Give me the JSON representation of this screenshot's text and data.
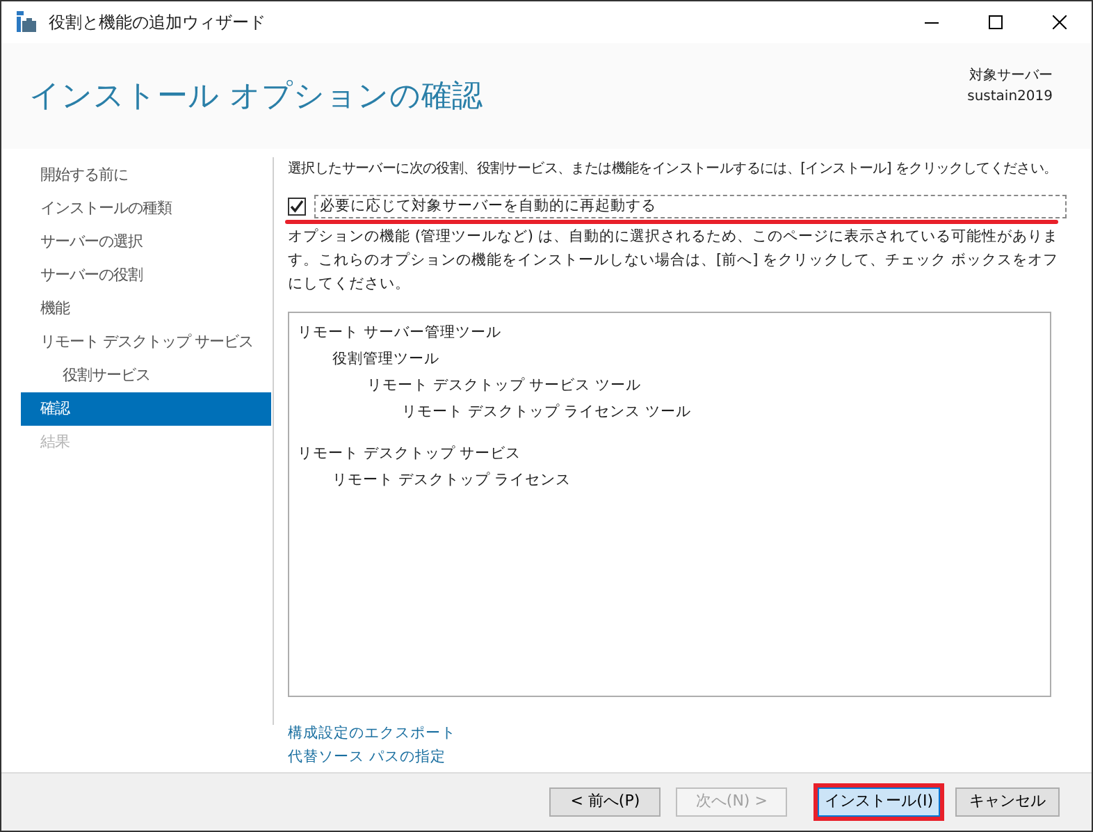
{
  "window": {
    "title": "役割と機能の追加ウィザード"
  },
  "header": {
    "title": "インストール オプションの確認",
    "target_label": "対象サーバー",
    "target_server": "sustain2019"
  },
  "sidebar": {
    "items": [
      {
        "label": "開始する前に",
        "selected": false,
        "disabled": false
      },
      {
        "label": "インストールの種類",
        "selected": false,
        "disabled": false
      },
      {
        "label": "サーバーの選択",
        "selected": false,
        "disabled": false
      },
      {
        "label": "サーバーの役割",
        "selected": false,
        "disabled": false
      },
      {
        "label": "機能",
        "selected": false,
        "disabled": false
      },
      {
        "label": "リモート デスクトップ サービス",
        "selected": false,
        "disabled": false,
        "children": [
          {
            "label": "役割サービス",
            "selected": false,
            "disabled": false
          }
        ]
      },
      {
        "label": "確認",
        "selected": true,
        "disabled": false
      },
      {
        "label": "結果",
        "selected": false,
        "disabled": true
      }
    ]
  },
  "instruction": "選択したサーバーに次の役割、役割サービス、または機能をインストールするには、[インストール] をクリックしてください。",
  "restart_checkbox": {
    "label": "必要に応じて対象サーバーを自動的に再起動する",
    "checked": true,
    "highlighted": true
  },
  "note": "オプションの機能 (管理ツールなど) は、自動的に選択されるため、このページに表示されている可能性があります。これらのオプションの機能をインストールしない場合は、[前へ] をクリックして、チェック ボックスをオフにしてください。",
  "install_list": [
    {
      "label": "リモート サーバー管理ツール",
      "children": [
        {
          "label": "役割管理ツール",
          "children": [
            {
              "label": "リモート デスクトップ サービス ツール",
              "children": [
                {
                  "label": "リモート デスクトップ ライセンス ツール"
                }
              ]
            }
          ]
        }
      ]
    },
    {
      "label": "リモート デスクトップ サービス",
      "children": [
        {
          "label": "リモート デスクトップ ライセンス"
        }
      ]
    }
  ],
  "links": [
    "構成設定のエクスポート",
    "代替ソース パスの指定"
  ],
  "buttons": [
    {
      "label": "< 前へ(P)",
      "disabled": false,
      "default": false,
      "highlighted": false
    },
    {
      "label": "次へ(N) >",
      "disabled": true,
      "default": false,
      "highlighted": false
    },
    {
      "label": "インストール(I)",
      "disabled": false,
      "default": true,
      "highlighted": true
    },
    {
      "label": "キャンセル",
      "disabled": false,
      "default": false,
      "highlighted": false
    }
  ]
}
